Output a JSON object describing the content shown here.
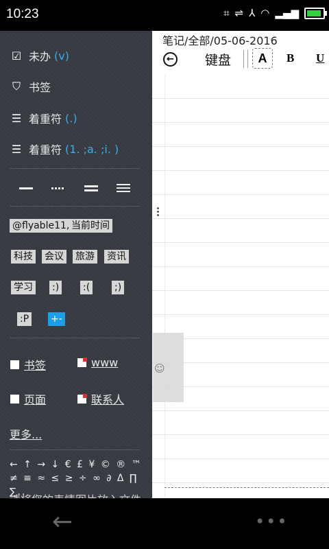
{
  "status_bar": {
    "time": "10:23"
  },
  "drawer": {
    "items": [
      {
        "label": "未办",
        "hint": "(v)"
      },
      {
        "label": "书签",
        "hint": ""
      },
      {
        "label": "着重符",
        "hint": "(.)"
      },
      {
        "label": "着重符",
        "hint": "(1. ;a. ;i. )"
      }
    ],
    "tags": [
      "@flyable11,",
      "当前时间",
      "科技",
      "会议",
      "旅游",
      "资讯",
      "学习",
      ":)",
      ":(",
      ";)",
      ":P",
      "+-"
    ],
    "links": [
      "书签",
      "www",
      "页面",
      "联系人"
    ],
    "more": "更多...",
    "symbols": "← ↑ → ↓ € £ ¥ © ® ™ ≠ ≡ ≈ ≤ ≥ ÷ ∞ ∂ Δ ∏ ∑..",
    "footer_hint": "请将您的表情图片放入文件"
  },
  "editor": {
    "breadcrumb": "笔记/全部/05-06-2016",
    "toolbar": {
      "keyboard": "键盘",
      "font_a": "A",
      "bold": "B",
      "underline": "U"
    }
  },
  "nav": {
    "back": "←",
    "more": "•••"
  }
}
